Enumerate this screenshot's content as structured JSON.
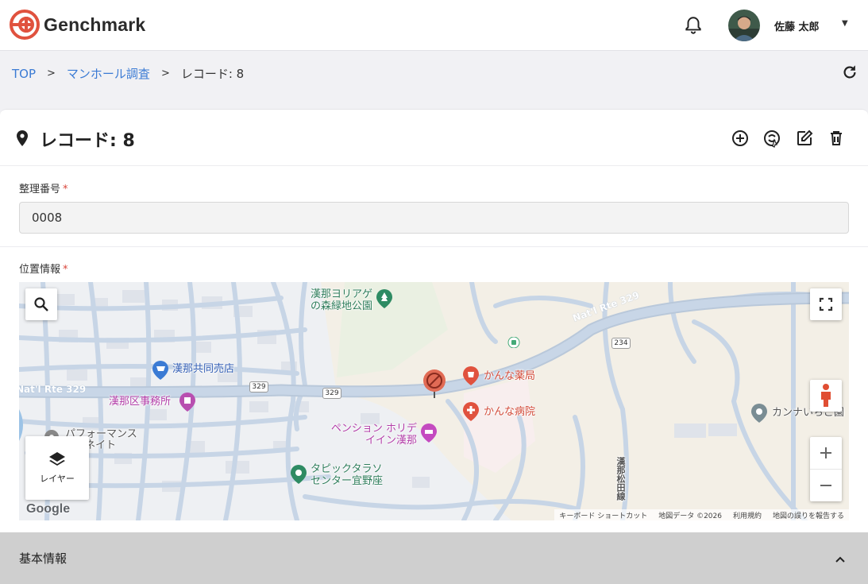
{
  "header": {
    "brand": "Genchmark",
    "user_name": "佐藤 太郎",
    "colors": {
      "brand_red": "#e0523e",
      "link_blue": "#3b7bd4"
    }
  },
  "breadcrumb": {
    "items": [
      {
        "label": "TOP"
      },
      {
        "label": "マンホール調査"
      },
      {
        "label": "レコード: 8"
      }
    ],
    "separator": ">"
  },
  "record": {
    "title": "レコード: 8",
    "actions": [
      "add-icon",
      "cloud-sync-icon",
      "edit-icon",
      "delete-icon"
    ]
  },
  "form": {
    "id_label": "整理番号",
    "id_value": "0008",
    "location_label": "位置情報",
    "required_mark": "*"
  },
  "map": {
    "layer_label": "レイヤー",
    "google_label": "Google",
    "roads": {
      "rte329_a": "Nat'l Rte 329",
      "rte329_b": "Nat'l Rte 329",
      "shield_329_a": "329",
      "shield_329_b": "329",
      "shield_234": "234",
      "matsuda": "漢那松田線"
    },
    "pois": {
      "park": "漢那ヨリアゲの森緑地公園",
      "store": "漢那共同売店",
      "office": "漢那区事務所",
      "performance": "パフォーマンスディネイト",
      "pharmacy": "かんな薬局",
      "hospital": "かんな病院",
      "pension": "ペンション ホリデイイン漢那",
      "center": "タピックタラソ センター宜野座",
      "kanna_garden": "カンナいちご園"
    },
    "attribution": {
      "shortcuts": "キーボード ショートカット",
      "data": "地図データ ©2026",
      "terms": "利用規約",
      "report": "地図の誤りを報告する"
    }
  },
  "accordion": {
    "title": "基本情報"
  }
}
